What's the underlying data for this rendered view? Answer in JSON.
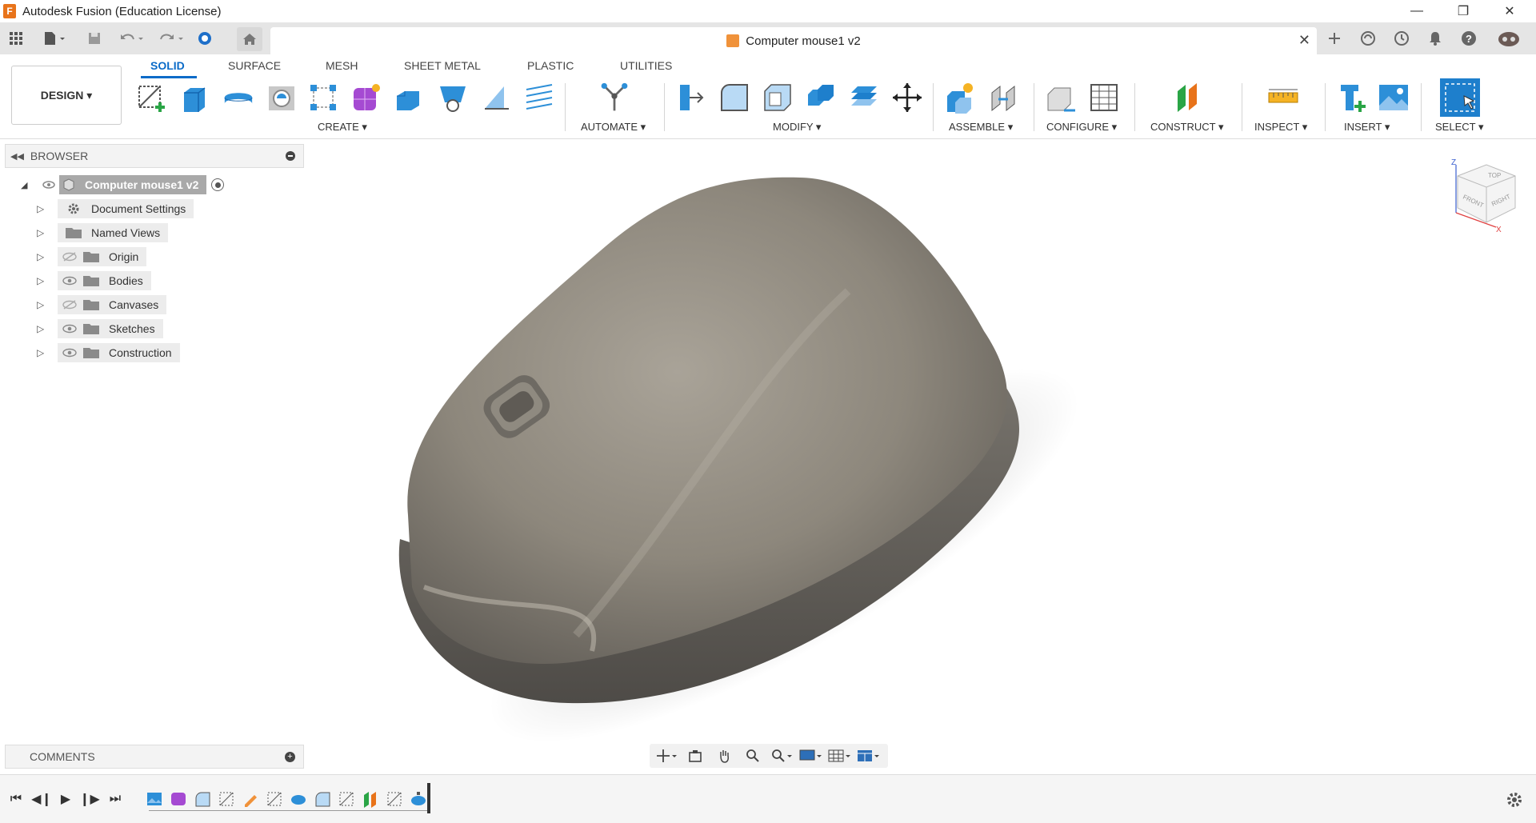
{
  "window": {
    "title": "Autodesk Fusion (Education License)",
    "app_icon_letter": "F"
  },
  "document_tab": {
    "name": "Computer mouse1 v2",
    "close": "✕"
  },
  "workspace": {
    "label": "DESIGN ▾"
  },
  "ribbon_tabs": [
    {
      "label": "SOLID",
      "active": true
    },
    {
      "label": "SURFACE",
      "active": false
    },
    {
      "label": "MESH",
      "active": false
    },
    {
      "label": "SHEET METAL",
      "active": false
    },
    {
      "label": "PLASTIC",
      "active": false
    },
    {
      "label": "UTILITIES",
      "active": false
    }
  ],
  "groups": {
    "create": "CREATE ▾",
    "automate": "AUTOMATE ▾",
    "modify": "MODIFY ▾",
    "assemble": "ASSEMBLE ▾",
    "configure": "CONFIGURE ▾",
    "construct": "CONSTRUCT ▾",
    "inspect": "INSPECT ▾",
    "insert": "INSERT ▾",
    "select": "SELECT ▾"
  },
  "browser": {
    "title": "BROWSER",
    "root": "Computer mouse1 v2",
    "items": [
      {
        "label": "Document Settings",
        "icon": "gear-icon"
      },
      {
        "label": "Named Views",
        "icon": "folder-icon"
      },
      {
        "label": "Origin",
        "icon": "folder-icon",
        "visibility": "hidden"
      },
      {
        "label": "Bodies",
        "icon": "folder-icon",
        "visibility": "visible"
      },
      {
        "label": "Canvases",
        "icon": "folder-icon",
        "visibility": "hidden"
      },
      {
        "label": "Sketches",
        "icon": "folder-icon",
        "visibility": "visible"
      },
      {
        "label": "Construction",
        "icon": "folder-icon",
        "visibility": "visible"
      }
    ]
  },
  "comments": {
    "title": "COMMENTS"
  },
  "viewcube": {
    "top": "TOP",
    "front": "FRONT",
    "right": "RIGHT",
    "axis_z": "Z",
    "axis_x": "X"
  },
  "colors": {
    "accent": "#0b6bc8",
    "tool_blue": "#2d8fd8",
    "body": "#8a857c"
  }
}
